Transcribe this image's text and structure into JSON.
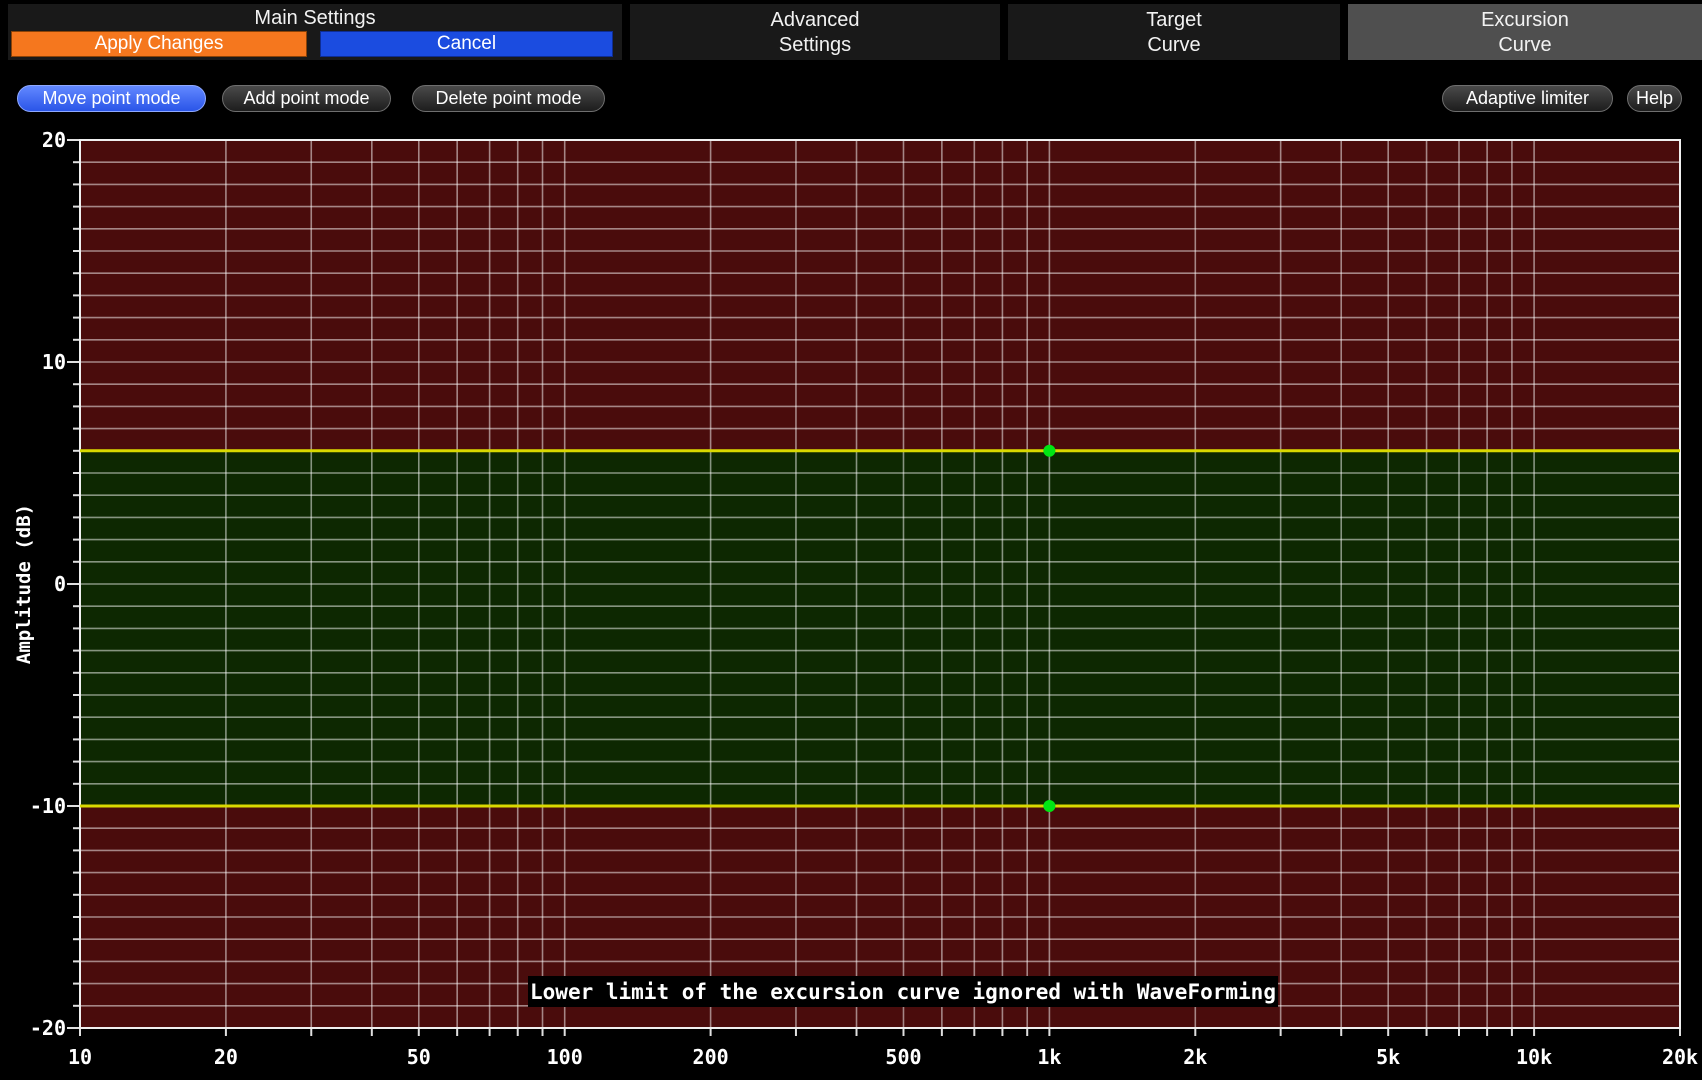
{
  "tabs": {
    "main": {
      "label": "Main Settings",
      "apply": "Apply Changes",
      "cancel": "Cancel"
    },
    "advanced": {
      "line1": "Advanced",
      "line2": "Settings"
    },
    "target": {
      "line1": "Target",
      "line2": "Curve"
    },
    "excursion": {
      "line1": "Excursion",
      "line2": "Curve"
    }
  },
  "toolbar": {
    "move": "Move point mode",
    "add": "Add point mode",
    "delete": "Delete point mode",
    "adaptive": "Adaptive limiter",
    "help": "Help"
  },
  "ui_colors": {
    "apply_orange": "#f5771e",
    "cancel_blue": "#1b4ce0",
    "active_pill_blue": "#3d66f0",
    "active_tab_gray": "#4f4f4f"
  },
  "chart_data": {
    "type": "line",
    "title": "",
    "x_axis": {
      "scale": "log",
      "min": 10,
      "max": 20000,
      "tick_values": [
        10,
        20,
        50,
        100,
        200,
        500,
        1000,
        2000,
        5000,
        10000,
        20000
      ],
      "tick_labels": [
        "10",
        "20",
        "50",
        "100",
        "200",
        "500",
        "1k",
        "2k",
        "5k",
        "10k",
        "20k"
      ]
    },
    "y_axis": {
      "label": "Amplitude (dB)",
      "min": -20,
      "max": 20,
      "tick_values": [
        20,
        10,
        0,
        -10,
        -20
      ],
      "grid_step_db": 1
    },
    "limits": {
      "upper_db": 6,
      "lower_db": -10,
      "handle_freq_hz": 1000
    },
    "series": [
      {
        "name": "upper excursion limit",
        "points": [
          {
            "hz": 10,
            "db": 6
          },
          {
            "hz": 1000,
            "db": 6
          },
          {
            "hz": 20000,
            "db": 6
          }
        ]
      },
      {
        "name": "lower excursion limit",
        "points": [
          {
            "hz": 10,
            "db": -10
          },
          {
            "hz": 1000,
            "db": -10
          },
          {
            "hz": 20000,
            "db": -10
          }
        ]
      }
    ],
    "annotation": "Lower limit of the excursion curve ignored with WaveForming",
    "grid_on": true,
    "legend_position": "none",
    "colors": {
      "excluded_fill": "#4a0c0c",
      "allowed_fill": "#0d2801",
      "grid": "rgba(255,255,255,0.5)",
      "limit_line": "#d9d900",
      "handle_point": "#00e614",
      "border": "#f0f0f0",
      "tick": "#e0e0e0",
      "axis_text": "#ffffff",
      "annotation_bg": "#000000",
      "annotation_text": "#ffffff"
    }
  }
}
